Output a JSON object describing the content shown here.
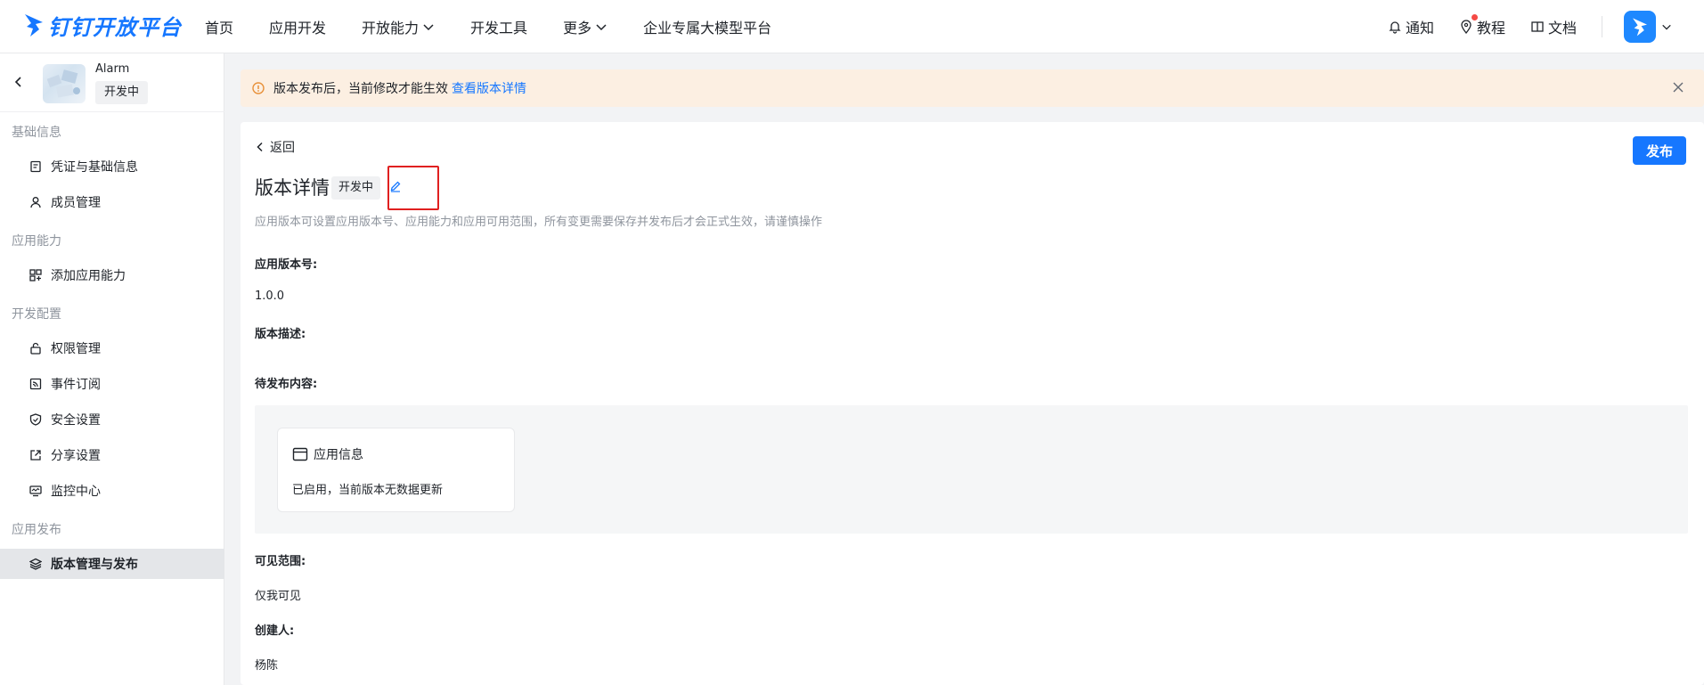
{
  "brand": {
    "name": "钉钉开放平台",
    "color": "#1677ff"
  },
  "nav": {
    "items": [
      {
        "label": "首页",
        "dropdown": false
      },
      {
        "label": "应用开发",
        "dropdown": false
      },
      {
        "label": "开放能力",
        "dropdown": true
      },
      {
        "label": "开发工具",
        "dropdown": false
      },
      {
        "label": "更多",
        "dropdown": true
      },
      {
        "label": "企业专属大模型平台",
        "dropdown": false
      }
    ],
    "notify": "通知",
    "tutorial": "教程",
    "docs": "文档"
  },
  "app": {
    "name": "Alarm",
    "status": "开发中"
  },
  "sidebar": {
    "sections": [
      {
        "title": "基础信息",
        "items": [
          {
            "label": "凭证与基础信息",
            "icon": "credential-icon"
          },
          {
            "label": "成员管理",
            "icon": "user-icon"
          }
        ]
      },
      {
        "title": "应用能力",
        "items": [
          {
            "label": "添加应用能力",
            "icon": "grid-add-icon"
          }
        ]
      },
      {
        "title": "开发配置",
        "items": [
          {
            "label": "权限管理",
            "icon": "lock-icon"
          },
          {
            "label": "事件订阅",
            "icon": "rss-icon"
          },
          {
            "label": "安全设置",
            "icon": "shield-icon"
          },
          {
            "label": "分享设置",
            "icon": "share-icon"
          },
          {
            "label": "监控中心",
            "icon": "monitor-icon"
          }
        ]
      },
      {
        "title": "应用发布",
        "items": [
          {
            "label": "版本管理与发布",
            "icon": "layers-icon",
            "active": true
          }
        ]
      }
    ]
  },
  "banner": {
    "text": "版本发布后，当前修改才能生效",
    "link": "查看版本详情"
  },
  "main": {
    "back": "返回",
    "publish": "发布",
    "title": "版本详情",
    "status": "开发中",
    "description": "应用版本可设置应用版本号、应用能力和应用可用范围，所有变更需要保存并发布后才会正式生效，请谨慎操作",
    "fields": {
      "version_label": "应用版本号:",
      "version_value": "1.0.0",
      "desc_label": "版本描述:",
      "pending_label": "待发布内容:",
      "scope_label": "可见范围:",
      "scope_value": "仅我可见",
      "creator_label": "创建人:",
      "creator_value": "杨陈"
    },
    "pending_card": {
      "title": "应用信息",
      "body": "已启用，当前版本无数据更新"
    }
  }
}
